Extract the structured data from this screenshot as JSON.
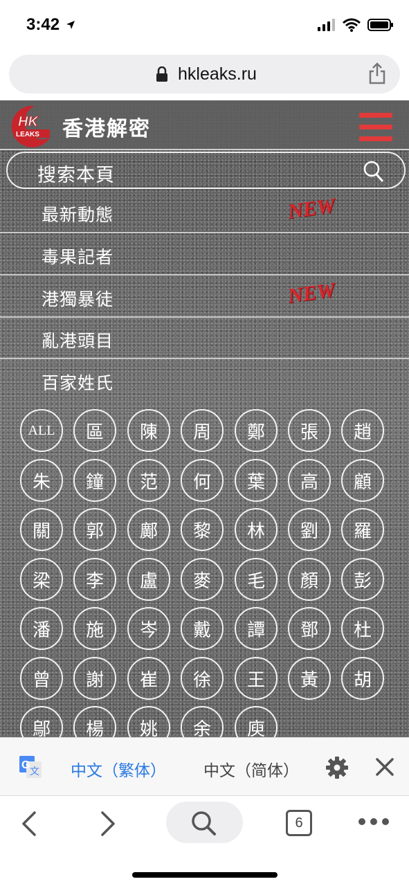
{
  "status_bar": {
    "time": "3:42"
  },
  "url_bar": {
    "url": "hkleaks.ru"
  },
  "site": {
    "logo_text": "HK LEAKS",
    "title": "香港解密",
    "search_placeholder": "搜索本頁",
    "menu": [
      {
        "label": "最新動態",
        "badge": "NEW"
      },
      {
        "label": "毒果記者",
        "badge": ""
      },
      {
        "label": "港獨暴徒",
        "badge": "NEW"
      },
      {
        "label": "亂港頭目",
        "badge": ""
      },
      {
        "label": "百家姓氏",
        "badge": ""
      }
    ],
    "surnames": [
      "ALL",
      "區",
      "陳",
      "周",
      "鄭",
      "張",
      "趙",
      "朱",
      "鐘",
      "范",
      "何",
      "葉",
      "高",
      "顧",
      "關",
      "郭",
      "鄺",
      "黎",
      "林",
      "劉",
      "羅",
      "梁",
      "李",
      "盧",
      "麥",
      "毛",
      "顏",
      "彭",
      "潘",
      "施",
      "岑",
      "戴",
      "譚",
      "鄧",
      "杜",
      "曾",
      "謝",
      "崔",
      "徐",
      "王",
      "黃",
      "胡",
      "鄔",
      "楊",
      "姚",
      "余",
      "庾"
    ]
  },
  "translate_bar": {
    "active_lang": "中文（繁体）",
    "other_lang": "中文（简体）"
  },
  "toolbar": {
    "tab_count": "6"
  },
  "colors": {
    "accent_red": "#e23a3a",
    "link_blue": "#2a7ae2"
  }
}
